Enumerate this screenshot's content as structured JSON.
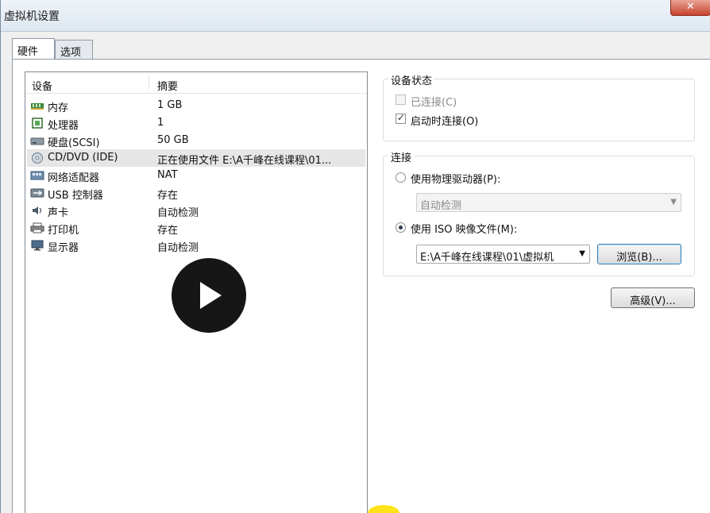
{
  "window": {
    "title": "虚拟机设置"
  },
  "tabs": [
    {
      "label": "硬件",
      "active": true
    },
    {
      "label": "选项",
      "active": false
    }
  ],
  "device_list": {
    "headers": {
      "device": "设备",
      "summary": "摘要"
    },
    "rows": [
      {
        "name": "内存",
        "summary": "1 GB",
        "icon": "memory-icon"
      },
      {
        "name": "处理器",
        "summary": "1",
        "icon": "cpu-icon"
      },
      {
        "name": "硬盘(SCSI)",
        "summary": "50 GB",
        "icon": "harddisk-icon"
      },
      {
        "name": "CD/DVD (IDE)",
        "summary": "正在使用文件 E:\\A千峰在线课程\\01...",
        "icon": "cd-dvd-icon",
        "selected": true
      },
      {
        "name": "网络适配器",
        "summary": "NAT",
        "icon": "network-adapter-icon"
      },
      {
        "name": "USB 控制器",
        "summary": "存在",
        "icon": "usb-icon"
      },
      {
        "name": "声卡",
        "summary": "自动检测",
        "icon": "sound-card-icon"
      },
      {
        "name": "打印机",
        "summary": "存在",
        "icon": "printer-icon"
      },
      {
        "name": "显示器",
        "summary": "自动检测",
        "icon": "monitor-icon"
      }
    ]
  },
  "device_status": {
    "legend": "设备状态",
    "connected": {
      "label": "已连接(C)",
      "checked": false,
      "disabled": true
    },
    "connect_at_power_on": {
      "label": "启动时连接(O)",
      "checked": true
    }
  },
  "connection": {
    "legend": "连接",
    "physical": {
      "label": "使用物理驱动器(P):",
      "selected": false,
      "dropdown_value": "自动检测"
    },
    "iso": {
      "label": "使用 ISO 映像文件(M):",
      "selected": true,
      "path": "E:\\A千峰在线课程\\01\\虚拟机",
      "browse_label": "浏览(B)..."
    }
  },
  "advanced_label": "高级(V)...",
  "colors": {
    "close_button": "#c7432f",
    "play_overlay": "#161616",
    "highlight": "#ffe21a"
  }
}
